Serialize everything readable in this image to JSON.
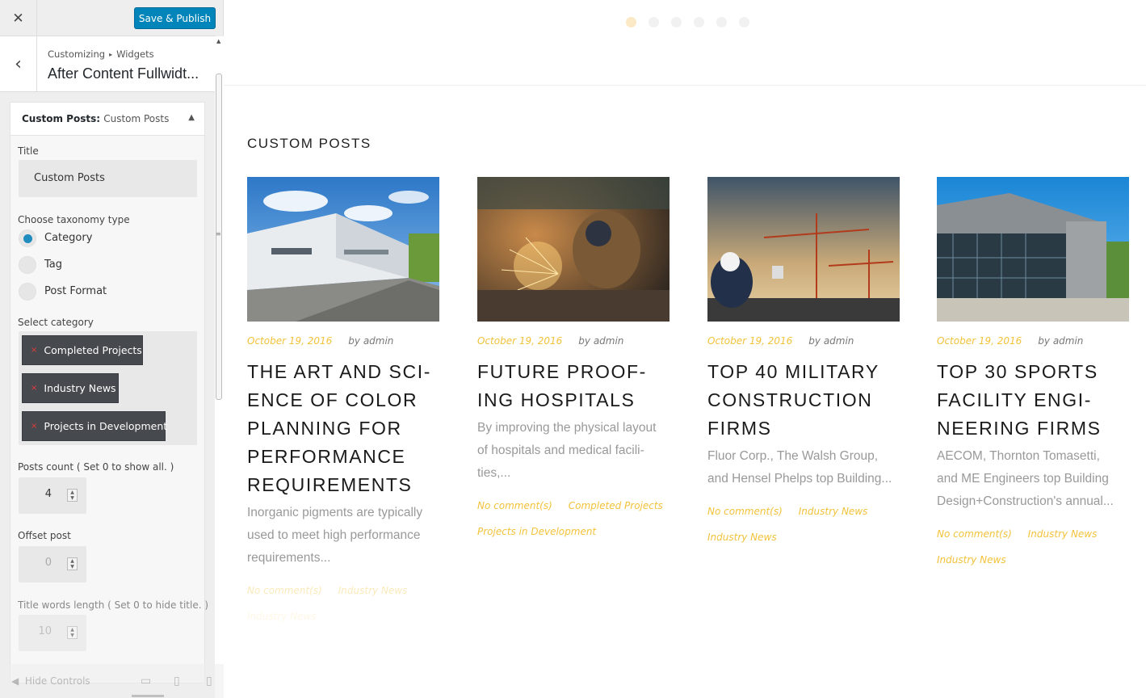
{
  "customizer": {
    "close_icon": "close-icon",
    "publish_label": "Save & Publish",
    "breadcrumb": [
      "Customizing",
      "Widgets"
    ],
    "section_title": "After Content Fullwidt...",
    "widget_title_bold": "Custom Posts:",
    "widget_title_instance": "Custom Posts",
    "title_label": "Title",
    "title_value": "Custom Posts",
    "taxonomy_label": "Choose taxonomy type",
    "taxonomy_options": [
      {
        "label": "Category",
        "selected": true
      },
      {
        "label": "Tag",
        "selected": false
      },
      {
        "label": "Post Format",
        "selected": false
      }
    ],
    "category_label": "Select category",
    "selected_categories": [
      "Completed Projects",
      "Industry News",
      "Projects in Development"
    ],
    "remove_glyph": "×",
    "posts_count_label": "Posts count ( Set 0 to show all. )",
    "posts_count_value": "4",
    "offset_label": "Offset post",
    "offset_value": "0",
    "title_words_label": "Title words length ( Set 0 to hide title. )",
    "title_words_value": "10",
    "hide_controls_label": "Hide Controls",
    "accent_color": "#0085ba"
  },
  "preview": {
    "section_heading": "CUSTOM POSTS",
    "slider_dots": 6,
    "active_dot": 0,
    "posts": [
      {
        "date": "October 19, 2016",
        "author": "by admin",
        "title": "THE ART AND SCI-ENCE OF COLOR PLANNING FOR PERFORMANCE REQUIREMENTS",
        "title_lines": [
          "THE ART AND SCI-",
          "ENCE OF COLOR",
          "PLANNING FOR",
          "PERFORMANCE",
          "REQUIREMENTS"
        ],
        "excerpt_lines": [
          "Inorganic pigments are typically",
          "used to meet high performance",
          "requirements..."
        ],
        "comments": "No comment(s)",
        "categories": [
          "Industry News",
          "Industry News"
        ],
        "image": "warehouse"
      },
      {
        "date": "October 19, 2016",
        "author": "by admin",
        "title_lines": [
          "FUTURE PROOF-",
          "ING HOSPITALS"
        ],
        "excerpt_lines": [
          "By improving the physical layout",
          "of hospitals and medical facili-",
          "ties,..."
        ],
        "comments": "No comment(s)",
        "categories": [
          "Completed Projects",
          "Projects in Development"
        ],
        "image": "welder"
      },
      {
        "date": "October 19, 2016",
        "author": "by admin",
        "title_lines": [
          "TOP 40 MILITARY",
          "CONSTRUCTION",
          "FIRMS"
        ],
        "excerpt_lines": [
          "Fluor Corp., The Walsh Group,",
          "and Hensel Phelps top Building..."
        ],
        "comments": "No comment(s)",
        "categories": [
          "Industry News",
          "Industry News"
        ],
        "image": "cranes"
      },
      {
        "date": "October 19, 2016",
        "author": "by admin",
        "title_lines": [
          "TOP 30 SPORTS",
          "FACILITY ENGI-",
          "NEERING FIRMS"
        ],
        "excerpt_lines": [
          "AECOM, Thornton Tomasetti,",
          "and ME Engineers top Building",
          "Design+Construction's annual..."
        ],
        "comments": "No comment(s)",
        "categories": [
          "Industry News",
          "Industry News"
        ],
        "image": "modern-building"
      }
    ],
    "date_color": "#f2c23a"
  }
}
